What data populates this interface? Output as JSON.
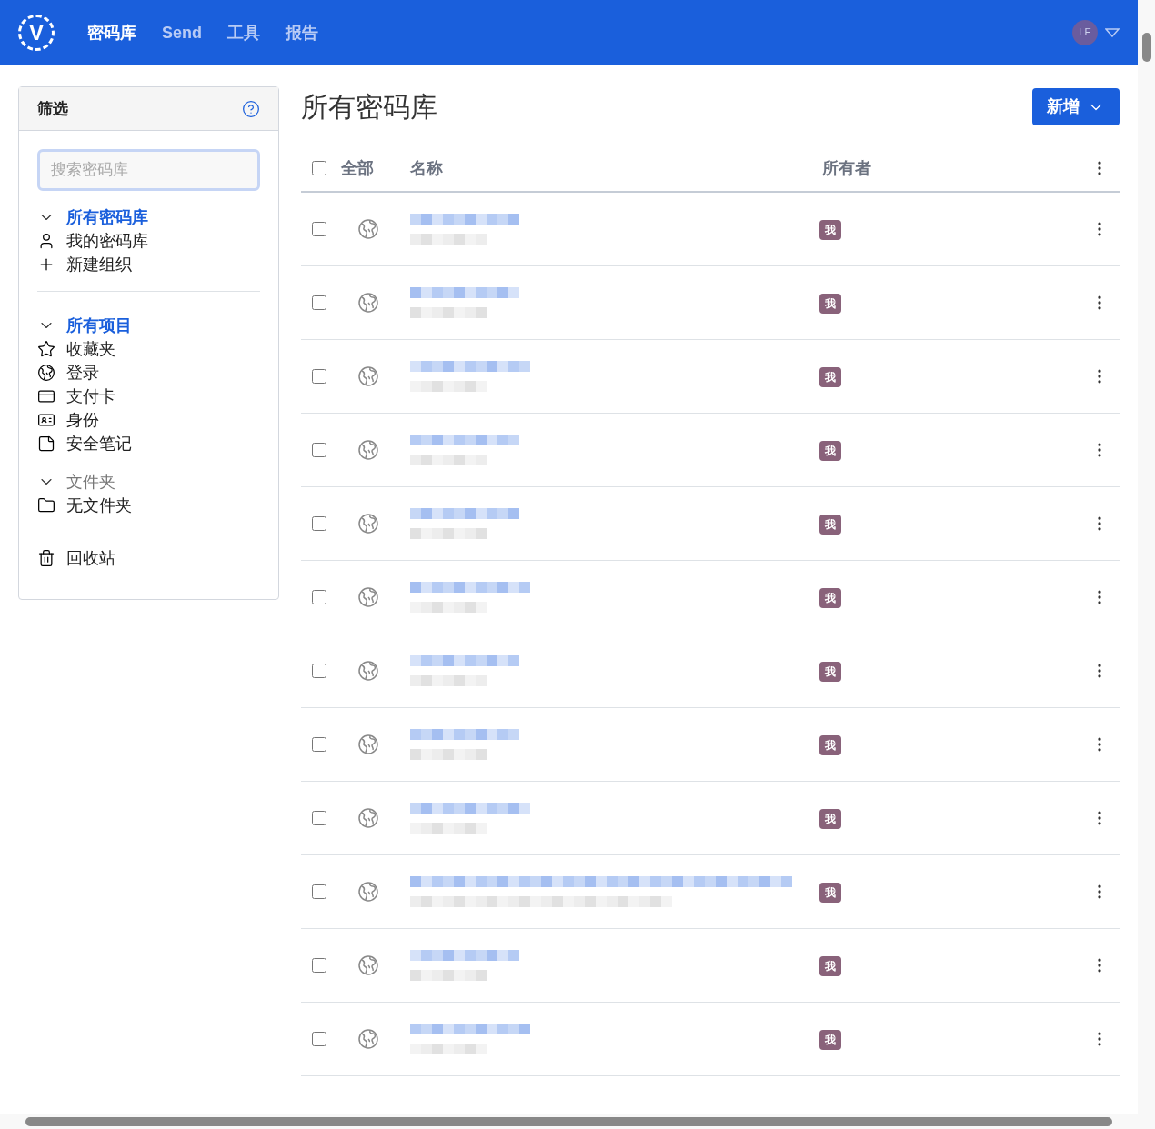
{
  "navbar": {
    "logo": "V",
    "items": [
      {
        "label": "密码库",
        "selected": true
      },
      {
        "label": "Send",
        "selected": false
      },
      {
        "label": "工具",
        "selected": false
      },
      {
        "label": "报告",
        "selected": false
      }
    ],
    "avatar": "LE"
  },
  "sidebar": {
    "title": "筛选",
    "search": {
      "placeholder": "搜索密码库"
    },
    "sections": [
      {
        "label": "所有密码库",
        "expanded": true,
        "selected": true,
        "items": [
          {
            "label": "我的密码库",
            "kind": "person"
          },
          {
            "label": "新建组织",
            "kind": "plus"
          }
        ]
      },
      {
        "label": "所有项目",
        "expanded": true,
        "selected": true,
        "items": [
          {
            "label": "收藏夹",
            "kind": "star"
          },
          {
            "label": "登录",
            "kind": "globe"
          },
          {
            "label": "支付卡",
            "kind": "card"
          },
          {
            "label": "身份",
            "kind": "id"
          },
          {
            "label": "安全笔记",
            "kind": "note"
          }
        ]
      },
      {
        "label": "文件夹",
        "expanded": true,
        "selected": false,
        "items": [
          {
            "label": "无文件夹",
            "kind": "folder"
          }
        ]
      },
      {
        "items": [
          {
            "label": "回收站",
            "kind": "trash"
          }
        ]
      }
    ]
  },
  "main": {
    "title": "所有密码库",
    "new_button": "新增",
    "table": {
      "columns": [
        "全部",
        "名称",
        "所有者"
      ],
      "select_all": false,
      "rows": [
        {
          "checked": false,
          "owner": "我"
        },
        {
          "checked": false,
          "owner": "我"
        },
        {
          "checked": false,
          "owner": "我"
        },
        {
          "checked": false,
          "owner": "我"
        },
        {
          "checked": false,
          "owner": "我"
        },
        {
          "checked": false,
          "owner": "我"
        },
        {
          "checked": false,
          "owner": "我"
        },
        {
          "checked": false,
          "owner": "我"
        },
        {
          "checked": false,
          "owner": "我"
        },
        {
          "checked": false,
          "owner": "我"
        },
        {
          "checked": false,
          "owner": "我"
        },
        {
          "checked": false,
          "owner": "我"
        }
      ]
    }
  }
}
